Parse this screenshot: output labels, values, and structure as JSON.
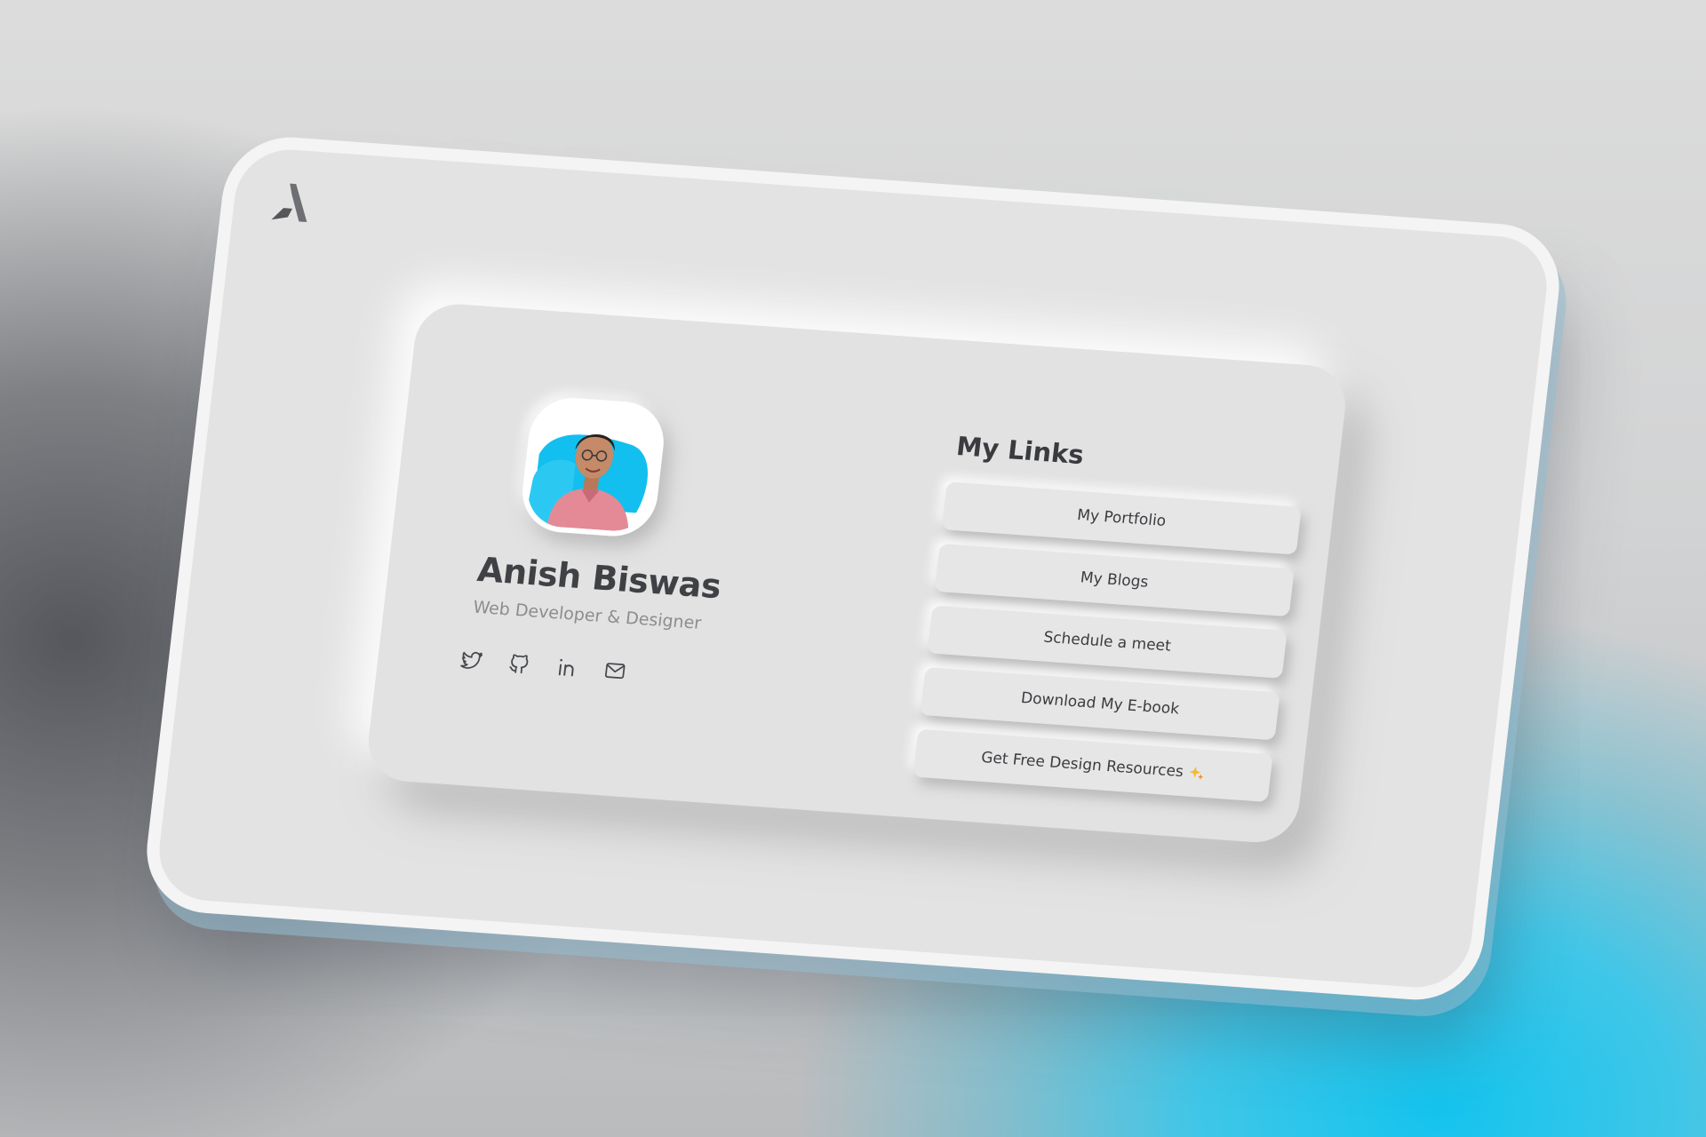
{
  "profile": {
    "name": "Anish Biswas",
    "title": "Web Developer & Designer",
    "avatar_icon": "profile-photo",
    "socials": [
      {
        "icon": "twitter-icon"
      },
      {
        "icon": "github-icon"
      },
      {
        "icon": "linkedin-icon"
      },
      {
        "icon": "mail-icon"
      }
    ]
  },
  "links": {
    "heading": "My Links",
    "items": [
      {
        "label": "My Portfolio"
      },
      {
        "label": "My Blogs"
      },
      {
        "label": "Schedule a meet"
      },
      {
        "label": "Download My E-book"
      },
      {
        "label": "Get Free Design Resources",
        "icon": "sparkle-icon"
      }
    ]
  },
  "colors": {
    "accent": "#14c4ee",
    "card": "#e2e2e2",
    "text": "#3f4145",
    "subtext": "#8c8d90"
  }
}
